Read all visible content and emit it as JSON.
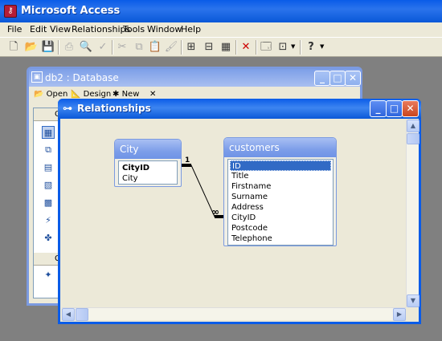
{
  "app": {
    "title": "Microsoft Access",
    "icon": "access-key-icon"
  },
  "menubar": [
    "File",
    "Edit",
    "View",
    "Relationships",
    "Tools",
    "Window",
    "Help"
  ],
  "toolbar": {
    "icons": [
      "new-icon",
      "open-icon",
      "save-icon",
      "print-icon",
      "print-preview-icon",
      "spelling-icon",
      "cut-icon",
      "copy-icon",
      "paste-icon",
      "format-painter-icon",
      "show-table-icon",
      "show-direct-icon",
      "show-all-icon",
      "delete-icon",
      "database-window-icon",
      "new-object-icon",
      "help-icon"
    ]
  },
  "db_window": {
    "title": "db2 : Database",
    "toolbar": {
      "open": "Open",
      "design": "Design",
      "new": "New"
    },
    "sidebar_heads": [
      "O",
      "G"
    ],
    "objects_icons": [
      "tables-icon",
      "queries-icon",
      "forms-icon",
      "reports-icon",
      "pages-icon",
      "macros-icon",
      "modules-icon",
      "groups-favorites-icon"
    ]
  },
  "rel_window": {
    "title": "Relationships",
    "tables": [
      {
        "name": "City",
        "fields": [
          {
            "name": "CityID",
            "key": true
          },
          {
            "name": "City",
            "key": false
          }
        ]
      },
      {
        "name": "customers",
        "fields": [
          {
            "name": "ID",
            "key": false,
            "selected": true
          },
          {
            "name": "Title"
          },
          {
            "name": "Firstname"
          },
          {
            "name": "Surname"
          },
          {
            "name": "Address"
          },
          {
            "name": "CityID"
          },
          {
            "name": "Postcode"
          },
          {
            "name": "Telephone"
          }
        ]
      }
    ],
    "relationship": {
      "from": "City.CityID",
      "to": "customers.CityID",
      "one_label": "1",
      "many_label": "∞"
    }
  }
}
